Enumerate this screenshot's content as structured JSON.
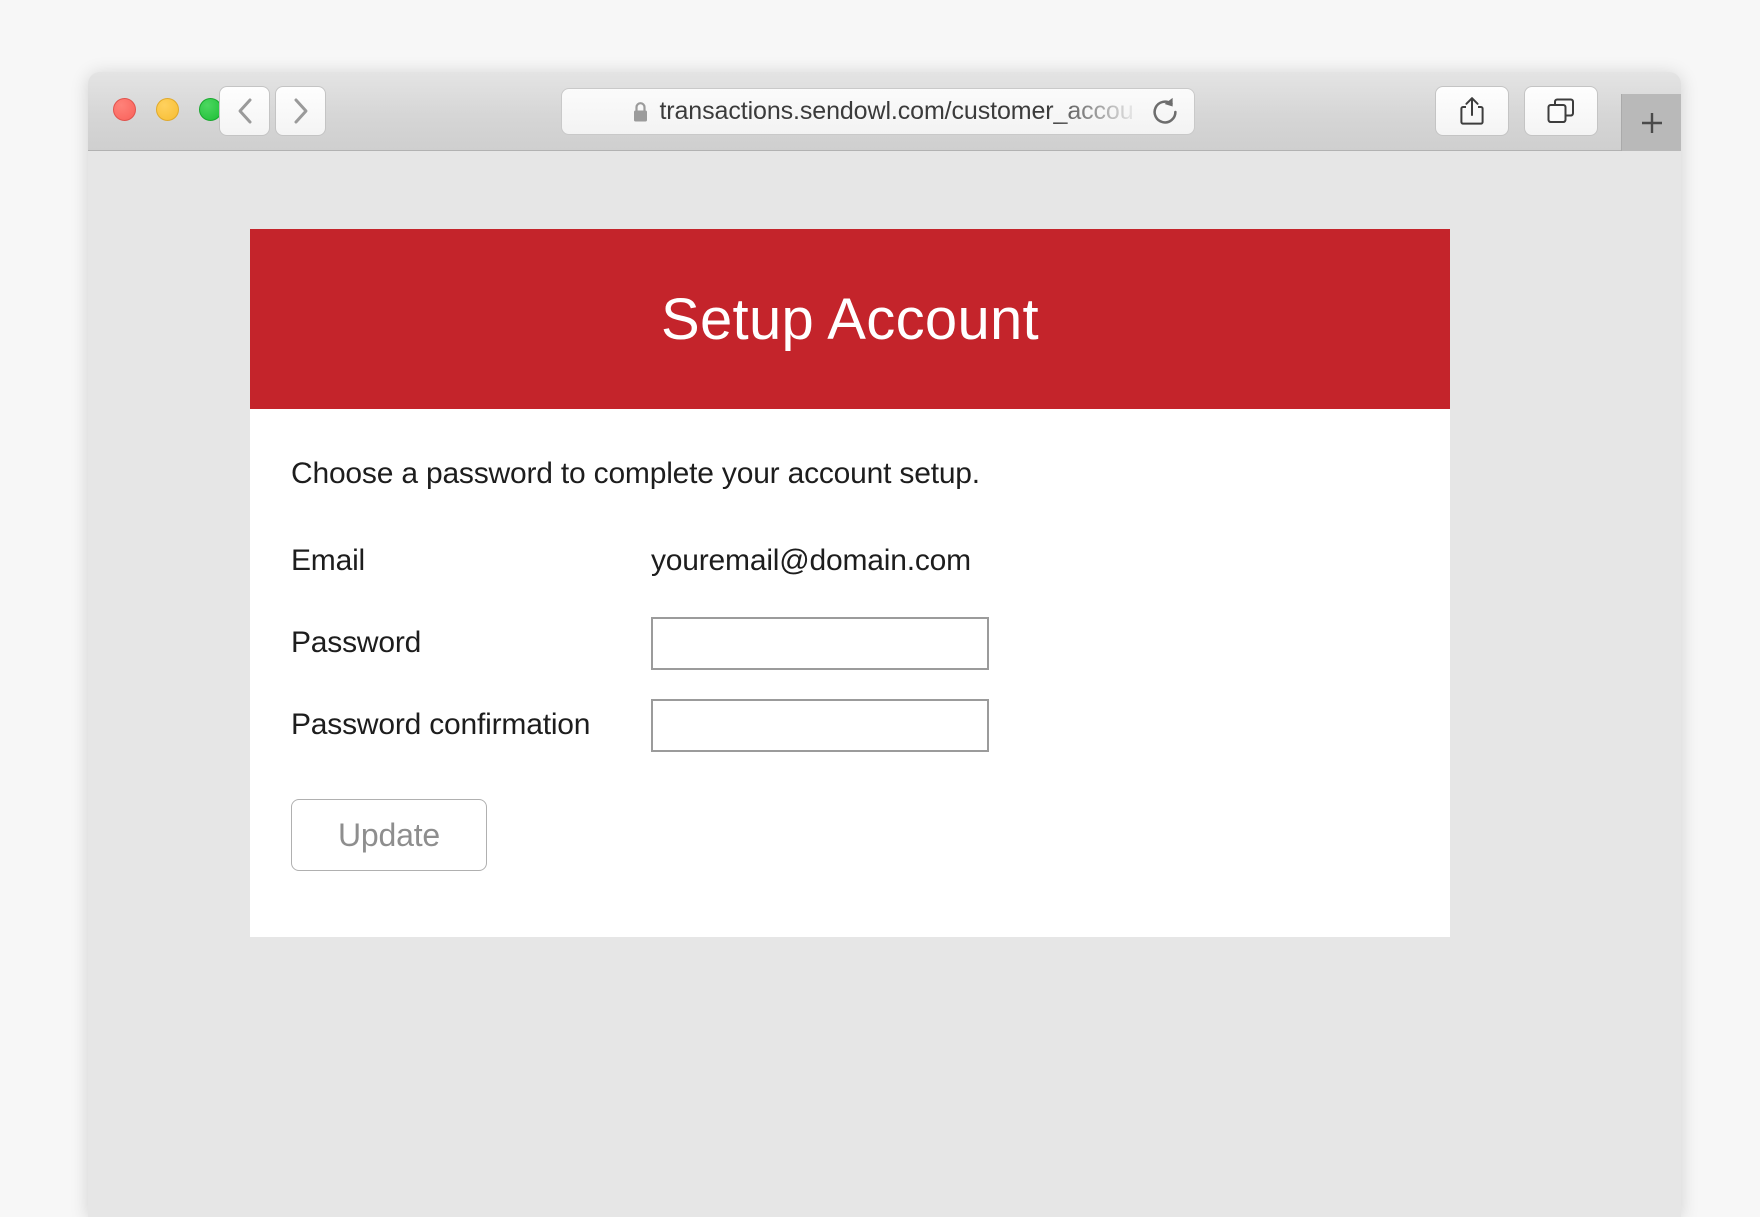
{
  "browser": {
    "traffic_lights": [
      {
        "name": "close",
        "color": "#f9615a"
      },
      {
        "name": "minimize",
        "color": "#f7bd32"
      },
      {
        "name": "zoom",
        "color": "#1dbe35"
      }
    ],
    "back_label": "Back",
    "forward_label": "Forward",
    "address": {
      "url_text": "transactions.sendowl.com/customer_accou",
      "secure": true,
      "lock_icon": "lock-icon",
      "reload_icon": "reload-icon"
    },
    "share_icon": "share-icon",
    "tabs_overview_icon": "tabs-overview-icon",
    "new_tab_icon": "plus-icon"
  },
  "page": {
    "background_color": "#e6e6e6",
    "card": {
      "header": {
        "title": "Setup Account",
        "background_color": "#c4242b",
        "text_color": "#ffffff"
      },
      "body": {
        "lead": "Choose a password to complete your account setup.",
        "fields": [
          {
            "label": "Email",
            "type": "static",
            "value": "youremail@domain.com"
          },
          {
            "label": "Password",
            "type": "password",
            "value": "",
            "placeholder": ""
          },
          {
            "label": "Password confirmation",
            "type": "password",
            "value": "",
            "placeholder": ""
          }
        ],
        "submit_label": "Update"
      }
    }
  }
}
